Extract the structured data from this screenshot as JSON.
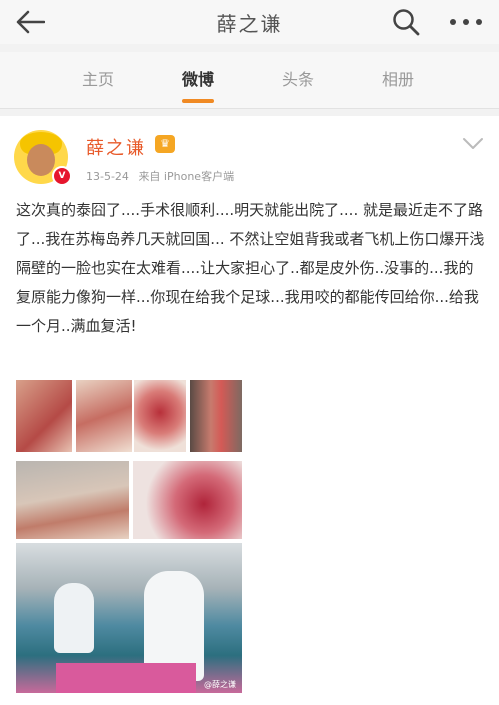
{
  "header": {
    "title": "薛之谦",
    "back_icon": "back-arrow-icon",
    "search_icon": "search-icon",
    "more_icon": "more-dots-icon"
  },
  "tabs": [
    {
      "label": "主页"
    },
    {
      "label": "微博"
    },
    {
      "label": "头条"
    },
    {
      "label": "相册"
    }
  ],
  "active_tab": "微博",
  "accent_color": "#f08a24",
  "post": {
    "author": "薛之谦",
    "date": "13-5-24",
    "source": "来自 iPhone客户端",
    "text": "这次真的泰囧了....手术很顺利....明天就能出院了.... 就是最近走不了路了...我在苏梅岛养几天就回国... 不然让空姐背我或者飞机上伤口爆开浅隔壁的一脸也实在太难看....让大家担心了..都是皮外伤..没事的...我的复原能力像狗一样...你现在给我个足球...我用咬的都能传回给你...给我一个月..满血复活!",
    "watermark": "@薛之谦"
  }
}
